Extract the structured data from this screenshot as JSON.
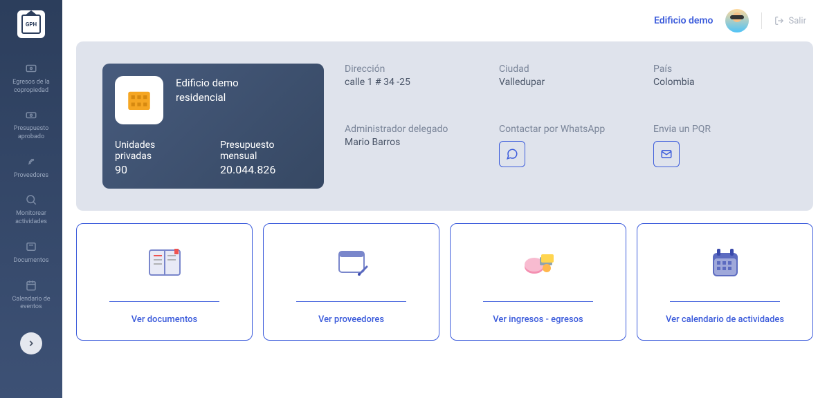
{
  "header": {
    "building_name": "Edificio demo",
    "logout": "Salir"
  },
  "sidebar": {
    "items": [
      {
        "label": "Egresos de la copropiedad"
      },
      {
        "label": "Presupuesto aprobado"
      },
      {
        "label": "Proveedores"
      },
      {
        "label": "Monitorear actividades"
      },
      {
        "label": "Documentos"
      },
      {
        "label": "Calendario de eventos"
      }
    ]
  },
  "info_card": {
    "title_line1": "Edificio demo",
    "title_line2": "residencial",
    "units_label": "Unidades privadas",
    "units_value": "90",
    "budget_label": "Presupuesto mensual",
    "budget_value": "20.044.826"
  },
  "info": {
    "direccion_label": "Dirección",
    "direccion_value": "calle 1 # 34 -25",
    "ciudad_label": "Ciudad",
    "ciudad_value": "Valledupar",
    "pais_label": "País",
    "pais_value": "Colombia",
    "admin_label": "Administrador delegado",
    "admin_value": "Mario Barros",
    "whatsapp_label": "Contactar por WhatsApp",
    "pqr_label": "Envia un PQR"
  },
  "actions": [
    {
      "label": "Ver documentos"
    },
    {
      "label": "Ver proveedores"
    },
    {
      "label": "Ver ingresos - egresos"
    },
    {
      "label": "Ver calendario de actividades"
    }
  ]
}
